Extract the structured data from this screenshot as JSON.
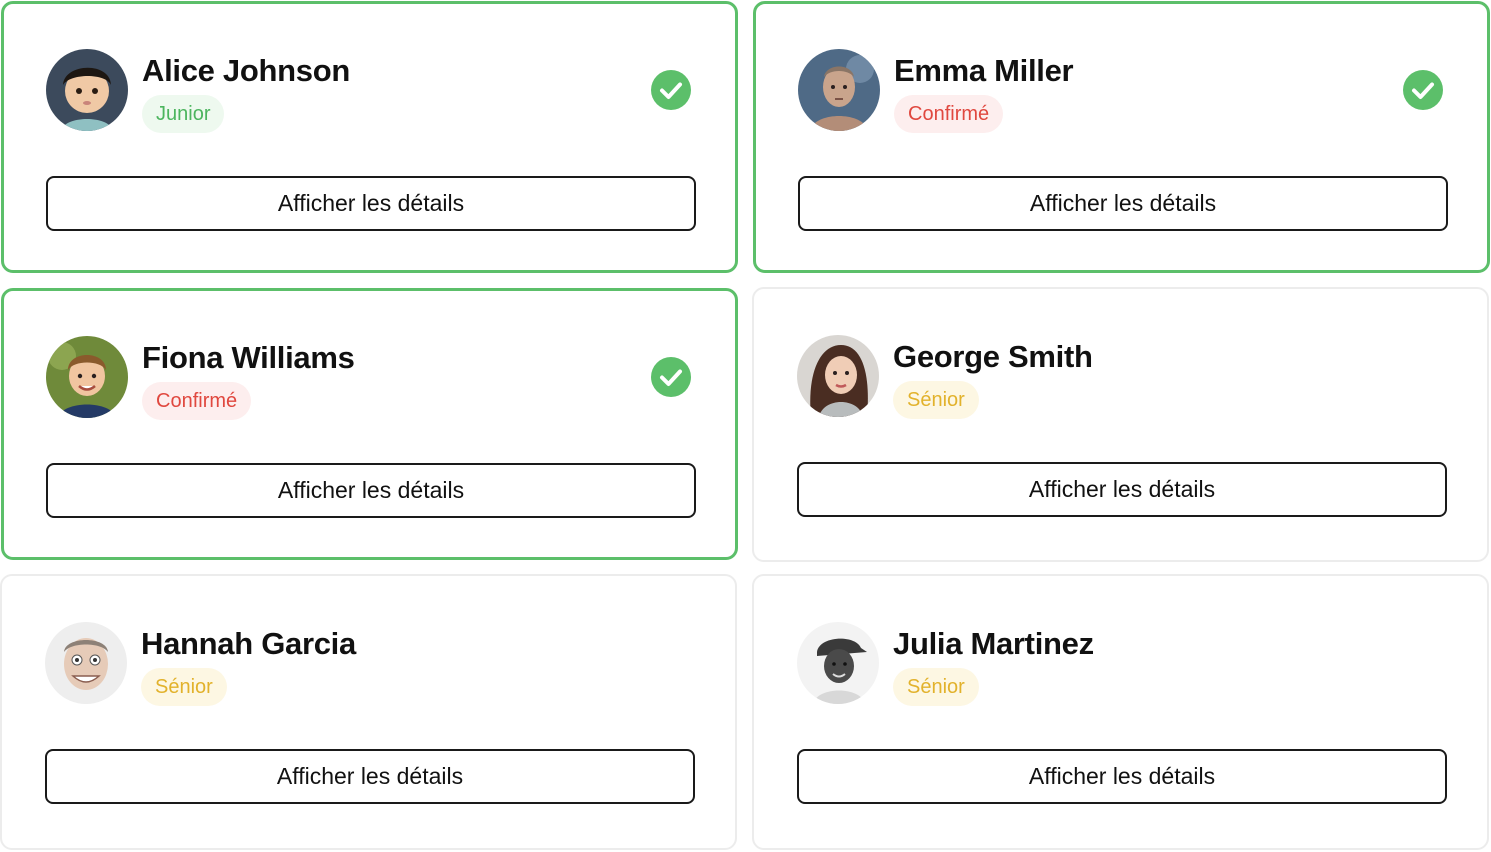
{
  "colors": {
    "selected_border": "#5cbf6a",
    "check": "#5cbf6a",
    "junior_text": "#4cb55e",
    "junior_bg": "#eef9ef",
    "confirme_text": "#e0483f",
    "confirme_bg": "#fdeeee",
    "senior_text": "#e2b22c",
    "senior_bg": "#fdf7e3"
  },
  "cards": [
    {
      "name": "Alice Johnson",
      "level": "Junior",
      "level_key": "junior",
      "selected": true,
      "button": "Afficher les détails",
      "avatar_icon": "child-portrait",
      "check_icon": "check-circle-icon"
    },
    {
      "name": "Emma Miller",
      "level": "Confirmé",
      "level_key": "confirme",
      "selected": true,
      "button": "Afficher les détails",
      "avatar_icon": "man-portrait",
      "check_icon": "check-circle-icon"
    },
    {
      "name": "Fiona Williams",
      "level": "Confirmé",
      "level_key": "confirme",
      "selected": true,
      "button": "Afficher les détails",
      "avatar_icon": "boy-portrait",
      "check_icon": "check-circle-icon"
    },
    {
      "name": "George Smith",
      "level": "Sénior",
      "level_key": "senior",
      "selected": false,
      "button": "Afficher les détails",
      "avatar_icon": "woman-portrait"
    },
    {
      "name": "Hannah Garcia",
      "level": "Sénior",
      "level_key": "senior",
      "selected": false,
      "button": "Afficher les détails",
      "avatar_icon": "funny-face-portrait"
    },
    {
      "name": "Julia Martinez",
      "level": "Sénior",
      "level_key": "senior",
      "selected": false,
      "button": "Afficher les détails",
      "avatar_icon": "man-cap-portrait"
    }
  ]
}
